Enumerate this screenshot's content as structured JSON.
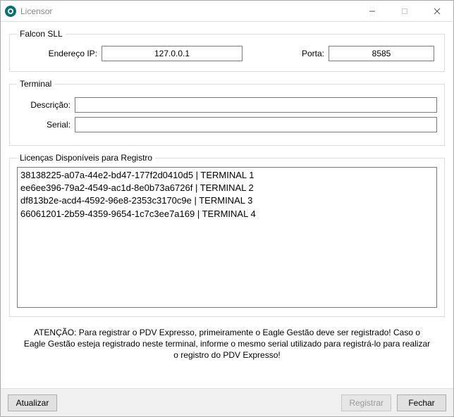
{
  "window": {
    "title": "Licensor"
  },
  "falcon": {
    "legend": "Falcon SLL",
    "ip_label": "Endereço IP:",
    "ip_value": "127.0.0.1",
    "porta_label": "Porta:",
    "porta_value": "8585"
  },
  "terminal": {
    "legend": "Terminal",
    "descricao_label": "Descrição:",
    "descricao_value": "",
    "serial_label": "Serial:",
    "serial_value": ""
  },
  "licencas": {
    "legend": "Licenças Disponíveis para Registro",
    "items": [
      "38138225-a07a-44e2-bd47-177f2d0410d5 | TERMINAL 1",
      "ee6ee396-79a2-4549-ac1d-8e0b73a6726f | TERMINAL 2",
      "df813b2e-acd4-4592-96e8-2353c3170c9e | TERMINAL 3",
      "66061201-2b59-4359-9654-1c7c3ee7a169 | TERMINAL 4"
    ]
  },
  "attention": "ATENÇÃO: Para registrar o PDV Expresso, primeiramente o Eagle Gestão deve ser registrado! Caso o Eagle Gestão esteja registrado neste terminal, informe o mesmo serial utilizado para registrá-lo para realizar o registro do PDV Expresso!",
  "buttons": {
    "atualizar": "Atualizar",
    "registrar": "Registrar",
    "fechar": "Fechar"
  }
}
